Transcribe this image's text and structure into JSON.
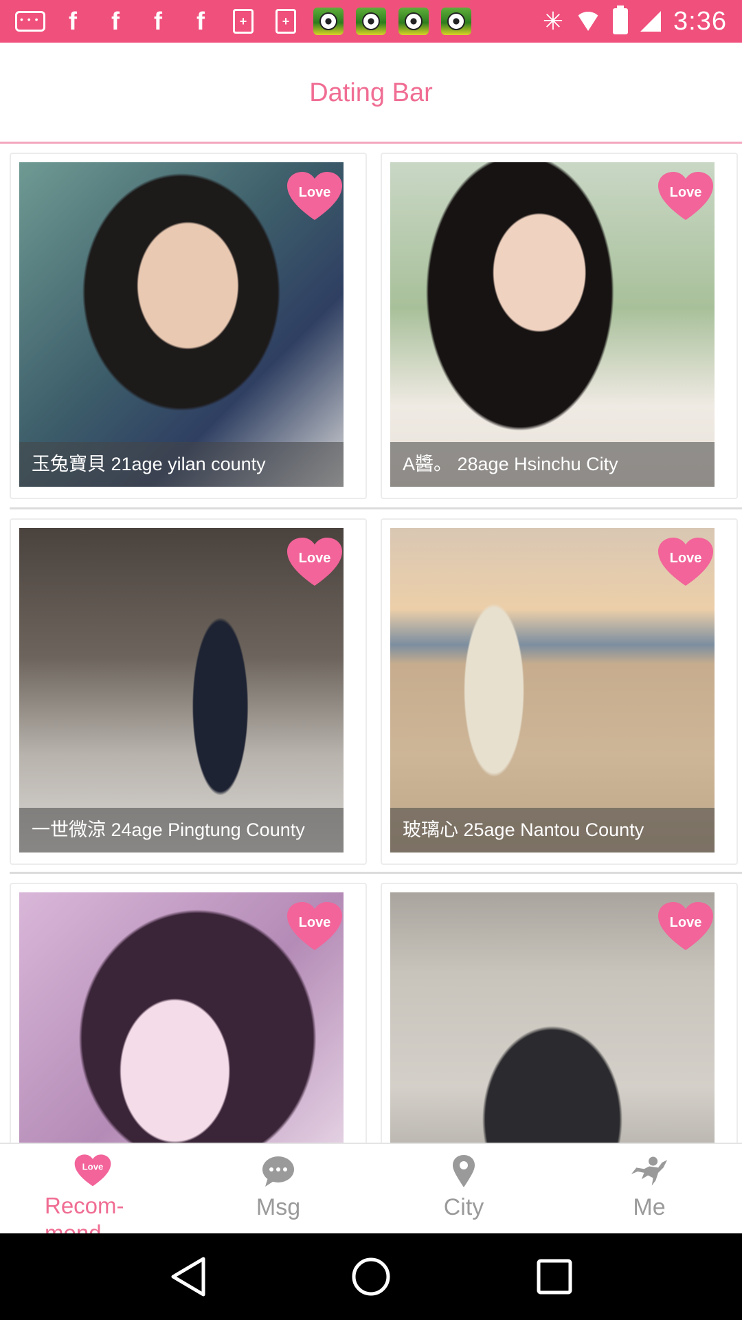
{
  "status_bar": {
    "time": "3:36",
    "notification_icons": [
      "messenger-icon",
      "facebook-icon",
      "facebook-icon",
      "facebook-icon",
      "facebook-icon",
      "calendar-icon",
      "calendar-icon",
      "soccer-game-icon",
      "soccer-game-icon",
      "soccer-game-icon",
      "soccer-game-icon"
    ],
    "system_icons": [
      "bluetooth-icon",
      "wifi-icon",
      "battery-icon",
      "signal-icon"
    ]
  },
  "header": {
    "title": "Dating Bar"
  },
  "profiles": [
    {
      "caption": "玉兔寶貝   21age  yilan county",
      "badge": "Love"
    },
    {
      "caption": "A醬。   28age  Hsinchu City",
      "badge": "Love"
    },
    {
      "caption": "一世微涼   24age  Pingtung County",
      "badge": "Love"
    },
    {
      "caption": "玻璃心   25age  Nantou County",
      "badge": "Love"
    },
    {
      "caption": "",
      "badge": "Love"
    },
    {
      "caption": "",
      "badge": "Love"
    }
  ],
  "tabs": [
    {
      "label": "Recom-mend",
      "icon": "love-heart-icon",
      "active": true
    },
    {
      "label": "Msg",
      "icon": "chat-bubble-icon",
      "active": false
    },
    {
      "label": "City",
      "icon": "location-pin-icon",
      "active": false
    },
    {
      "label": "Me",
      "icon": "cupid-icon",
      "active": false
    }
  ],
  "colors": {
    "accent": "#f06d93",
    "status_bar": "#f0507c",
    "inactive_tab": "#9a9a9a"
  }
}
